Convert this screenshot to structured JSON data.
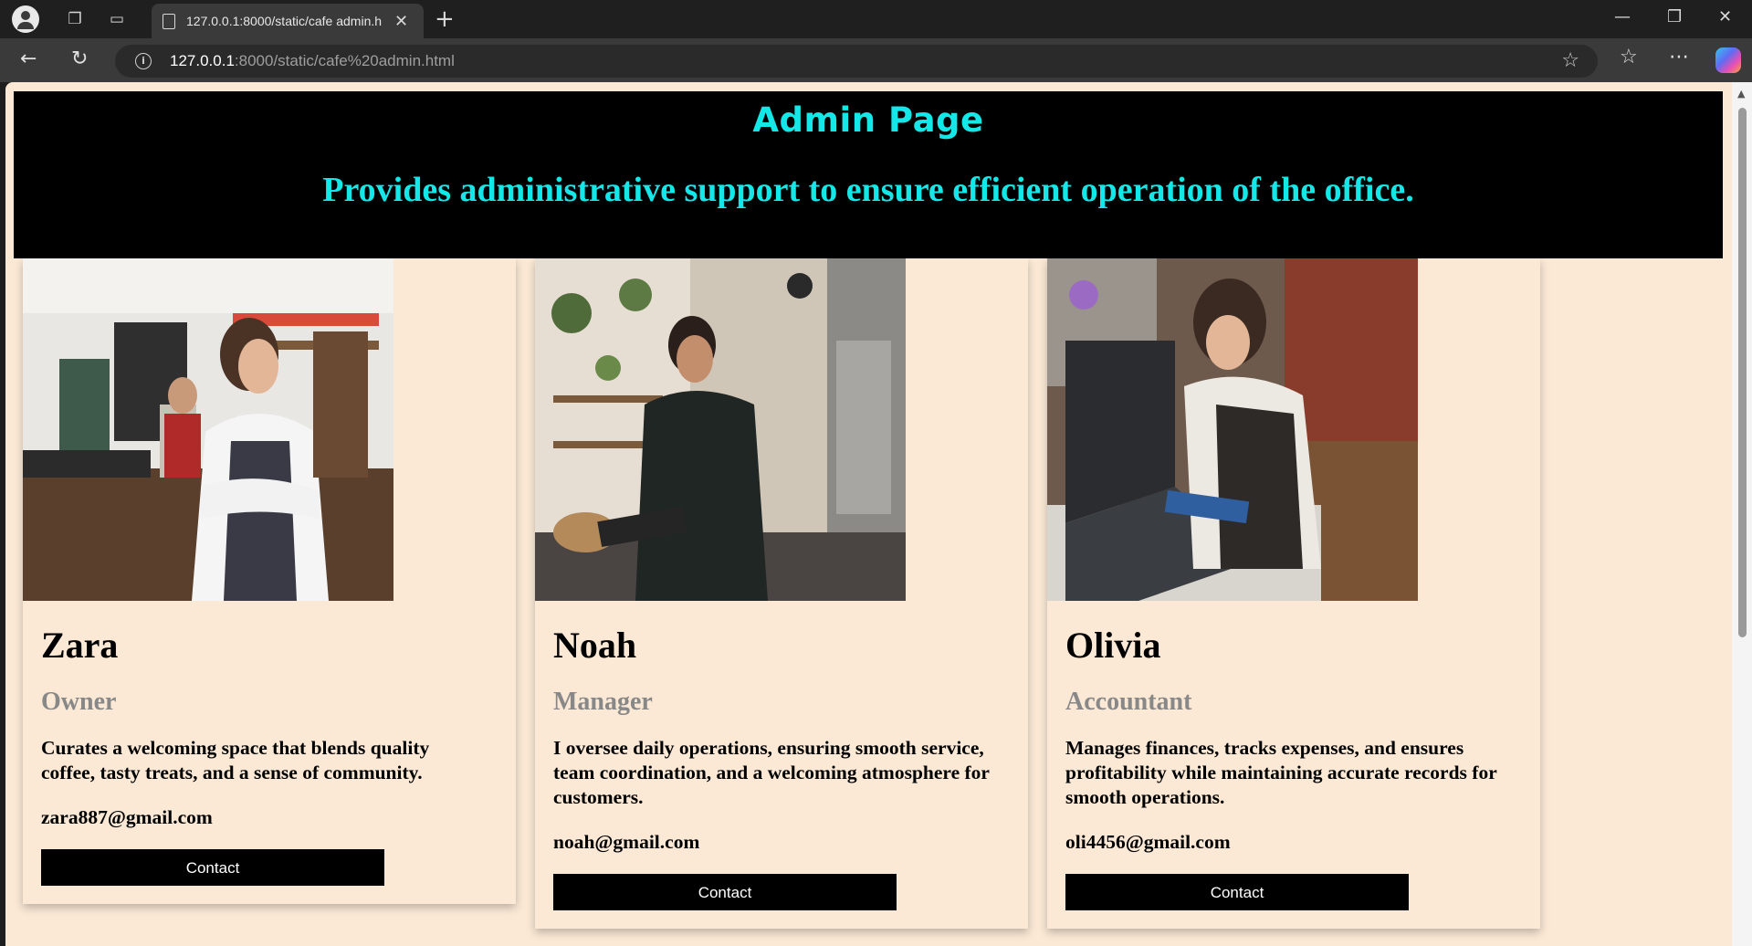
{
  "browser": {
    "tab_title": "127.0.0.1:8000/static/cafe admin.h",
    "url_host": "127.0.0.1",
    "url_rest": ":8000/static/cafe%20admin.html"
  },
  "header": {
    "title": "Admin Page",
    "subtitle": "Provides administrative support to ensure efficient operation of the office."
  },
  "cards": [
    {
      "name": "Zara",
      "role": "Owner",
      "description": "Curates a welcoming space that blends quality coffee, tasty treats, and a sense of community.",
      "email": "zara887@gmail.com",
      "button": "Contact"
    },
    {
      "name": "Noah",
      "role": "Manager",
      "description": "I oversee daily operations, ensuring smooth service, team coordination, and a welcoming atmosphere for customers.",
      "email": "noah@gmail.com",
      "button": "Contact"
    },
    {
      "name": "Olivia",
      "role": "Accountant",
      "description": "Manages finances, tracks expenses, and ensures profitability while maintaining accurate records for smooth operations.",
      "email": "oli4456@gmail.com",
      "button": "Contact"
    }
  ],
  "colors": {
    "page_background": "#fbe9d6",
    "header_background": "#000000",
    "header_text": "#14e7e7",
    "role_text": "#888888",
    "button_background": "#000000"
  }
}
